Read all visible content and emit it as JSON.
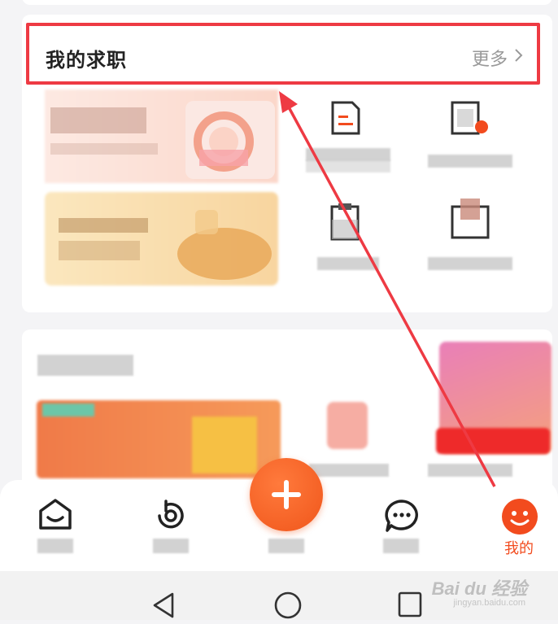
{
  "job_section": {
    "title": "我的求职",
    "more_label": "更多",
    "more_icon": "chevron-right-icon"
  },
  "bottom_nav": {
    "tabs": [
      {
        "icon": "home-icon"
      },
      {
        "icon": "activity-icon"
      },
      {
        "icon": "plus-icon",
        "role": "publish"
      },
      {
        "icon": "message-icon"
      },
      {
        "icon": "profile-face-icon",
        "label": "我的",
        "active": true
      }
    ],
    "active_color": "#f24b1e"
  },
  "system_nav": {
    "buttons": [
      "back-icon",
      "home-circle-icon",
      "recents-icon"
    ]
  },
  "watermark": {
    "brand": "Bai du 经验",
    "sub": "jingyan.baidu.com"
  },
  "annotation": {
    "highlight_color": "#ee3a43"
  }
}
